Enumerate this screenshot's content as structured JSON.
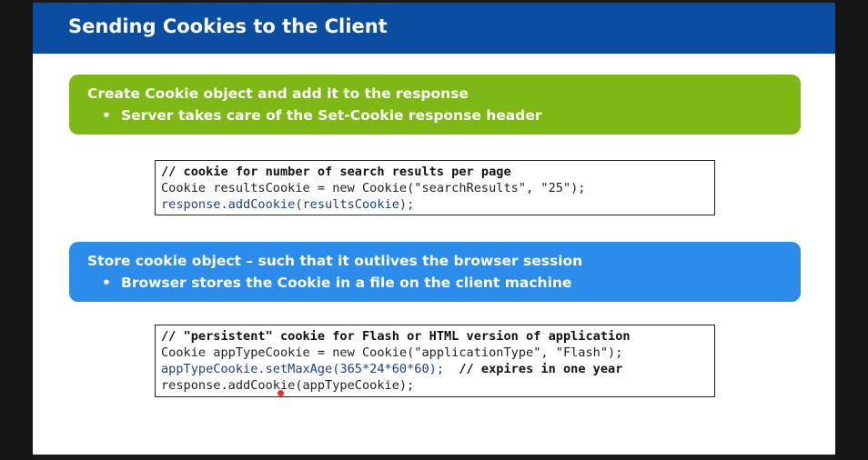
{
  "slide": {
    "title": "Sending Cookies to the Client"
  },
  "callouts": [
    {
      "heading": "Create Cookie object and add it to the response",
      "bullet": "Server takes care of the Set-Cookie response header",
      "color": "#7db814"
    },
    {
      "heading": "Store cookie object –  such that it outlives the browser session",
      "bullet": "Browser stores the Cookie in a file on the client machine",
      "color": "#2c8ceb"
    }
  ],
  "bullet_glyph": "•",
  "code_blocks": [
    {
      "lines": [
        "// cookie for number of search results per page",
        "Cookie resultsCookie = new Cookie(\"searchResults\", \"25\");",
        "response.addCookie(resultsCookie);"
      ]
    },
    {
      "lines": [
        "// \"persistent\" cookie for Flash or HTML version of application",
        "Cookie appTypeCookie = new Cookie(\"applicationType\", \"Flash\");",
        "appTypeCookie.setMaxAge(365*24*60*60);",
        "  // expires in one year",
        "response.addCookie(appTypeCookie);"
      ]
    }
  ],
  "colors": {
    "title_bar": "#0b4ea1",
    "code_blue": "#1c3f8a",
    "cursor": "#e8322a"
  }
}
